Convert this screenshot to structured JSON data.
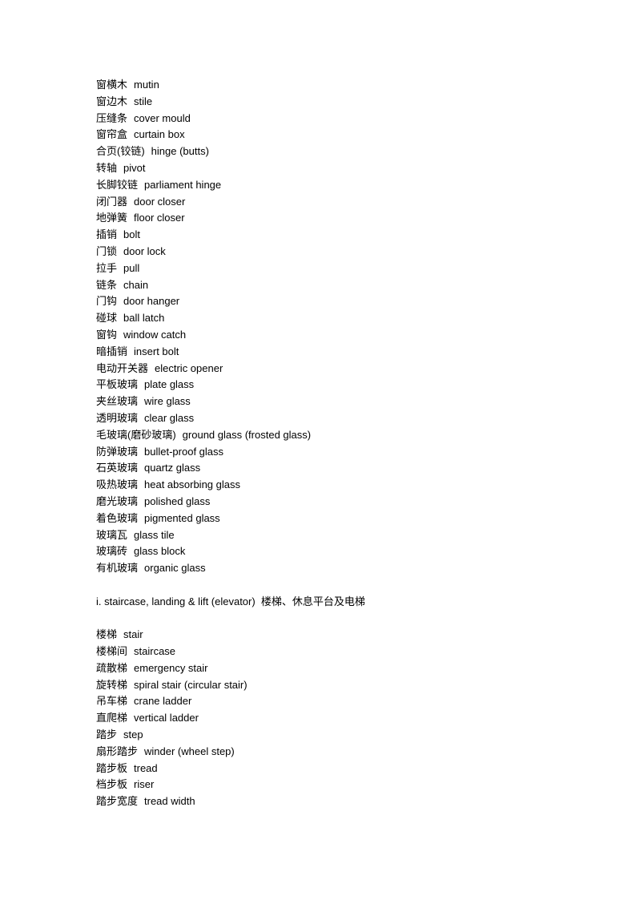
{
  "section1": {
    "entries": [
      {
        "zh": "窗横木",
        "en": "mutin"
      },
      {
        "zh": "窗边木",
        "en": "stile"
      },
      {
        "zh": "压缝条",
        "en": "cover mould"
      },
      {
        "zh": "窗帘盒",
        "en": "curtain box"
      },
      {
        "zh": "合页(铰链)",
        "en": "hinge (butts)"
      },
      {
        "zh": "转轴",
        "en": "pivot"
      },
      {
        "zh": "长脚铰链",
        "en": "parliament hinge"
      },
      {
        "zh": "闭门器",
        "en": "door closer"
      },
      {
        "zh": "地弹簧",
        "en": "floor closer"
      },
      {
        "zh": "插销",
        "en": "bolt"
      },
      {
        "zh": "门锁",
        "en": "door lock"
      },
      {
        "zh": "拉手",
        "en": "pull"
      },
      {
        "zh": "链条",
        "en": "chain"
      },
      {
        "zh": "门钩",
        "en": "door hanger"
      },
      {
        "zh": "碰球",
        "en": "ball latch"
      },
      {
        "zh": "窗钩",
        "en": "window catch"
      },
      {
        "zh": "暗插销",
        "en": "insert bolt"
      },
      {
        "zh": "电动开关器",
        "en": "electric opener"
      },
      {
        "zh": "平板玻璃",
        "en": "plate glass"
      },
      {
        "zh": "夹丝玻璃",
        "en": "wire glass"
      },
      {
        "zh": "透明玻璃",
        "en": "clear glass"
      },
      {
        "zh": "毛玻璃(磨砂玻璃)",
        "en": "ground glass (frosted glass)"
      },
      {
        "zh": "防弹玻璃",
        "en": "bullet-proof glass"
      },
      {
        "zh": "石英玻璃",
        "en": "quartz glass"
      },
      {
        "zh": "吸热玻璃",
        "en": "heat absorbing glass"
      },
      {
        "zh": "磨光玻璃",
        "en": "polished glass"
      },
      {
        "zh": "着色玻璃",
        "en": "pigmented glass"
      },
      {
        "zh": "玻璃瓦",
        "en": "glass tile"
      },
      {
        "zh": "玻璃砖",
        "en": "glass block"
      },
      {
        "zh": "有机玻璃",
        "en": "organic glass"
      }
    ]
  },
  "section2": {
    "heading": "i. staircase, landing & lift (elevator)  楼梯、休息平台及电梯",
    "entries": [
      {
        "zh": "楼梯",
        "en": "stair"
      },
      {
        "zh": "楼梯间",
        "en": "staircase"
      },
      {
        "zh": "疏散梯",
        "en": "emergency stair"
      },
      {
        "zh": "旋转梯",
        "en": "spiral stair (circular stair)"
      },
      {
        "zh": "吊车梯",
        "en": "crane ladder"
      },
      {
        "zh": "直爬梯",
        "en": "vertical ladder"
      },
      {
        "zh": "踏步",
        "en": "step"
      },
      {
        "zh": "扇形踏步",
        "en": "winder (wheel step)"
      },
      {
        "zh": "踏步板",
        "en": "tread"
      },
      {
        "zh": "档步板",
        "en": "riser"
      },
      {
        "zh": "踏步宽度",
        "en": "tread width"
      }
    ]
  }
}
